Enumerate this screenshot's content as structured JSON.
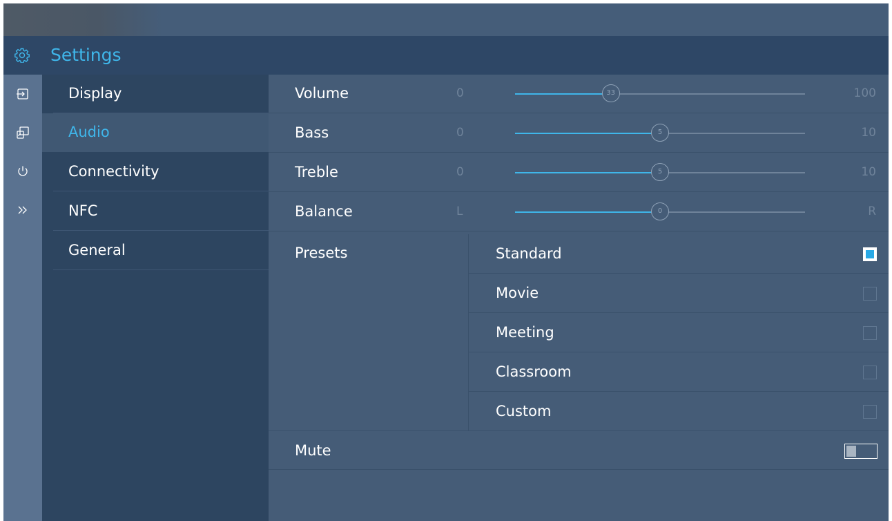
{
  "header": {
    "title": "Settings",
    "icon": "gear-icon"
  },
  "rail": [
    {
      "icon": "input-source-icon"
    },
    {
      "icon": "screen-mirror-icon"
    },
    {
      "icon": "power-icon"
    },
    {
      "icon": "chevron-double-right-icon"
    }
  ],
  "categories": [
    {
      "label": "Display",
      "active": false
    },
    {
      "label": "Audio",
      "active": true
    },
    {
      "label": "Connectivity",
      "active": false
    },
    {
      "label": "NFC",
      "active": false
    },
    {
      "label": "General",
      "active": false
    }
  ],
  "sliders": [
    {
      "label": "Volume",
      "min_label": "0",
      "max_label": "100",
      "value": 33,
      "value_label": "33",
      "min": 0,
      "max": 100
    },
    {
      "label": "Bass",
      "min_label": "0",
      "max_label": "10",
      "value": 5,
      "value_label": "5",
      "min": 0,
      "max": 10
    },
    {
      "label": "Treble",
      "min_label": "0",
      "max_label": "10",
      "value": 5,
      "value_label": "5",
      "min": 0,
      "max": 10
    },
    {
      "label": "Balance",
      "min_label": "L",
      "max_label": "R",
      "value": 0,
      "value_label": "0",
      "min": -50,
      "max": 50
    }
  ],
  "presets": {
    "label": "Presets",
    "options": [
      {
        "label": "Standard",
        "checked": true
      },
      {
        "label": "Movie",
        "checked": false
      },
      {
        "label": "Meeting",
        "checked": false
      },
      {
        "label": "Classroom",
        "checked": false
      },
      {
        "label": "Custom",
        "checked": false
      }
    ]
  },
  "mute": {
    "label": "Mute",
    "on": false
  },
  "colors": {
    "accent": "#3fb6ea",
    "panel": "#455c77",
    "sidebar": "#2d4560",
    "rail": "#5a7290"
  }
}
